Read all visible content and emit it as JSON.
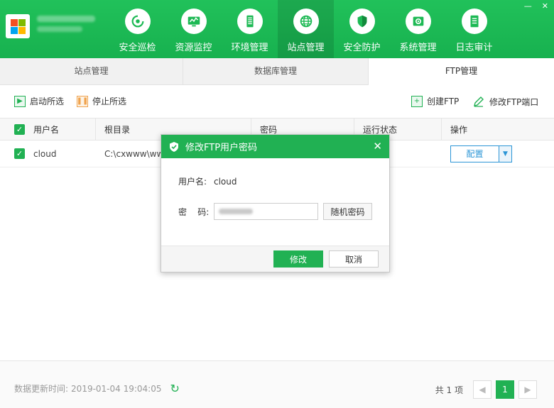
{
  "header": {
    "nav": [
      {
        "label": "安全巡检",
        "icon": "scan-icon"
      },
      {
        "label": "资源监控",
        "icon": "monitor-chart-icon"
      },
      {
        "label": "环境管理",
        "icon": "server-icon"
      },
      {
        "label": "站点管理",
        "icon": "globe-icon",
        "active": true
      },
      {
        "label": "安全防护",
        "icon": "shield-icon"
      },
      {
        "label": "系统管理",
        "icon": "settings-icon"
      },
      {
        "label": "日志审计",
        "icon": "document-icon"
      }
    ],
    "window": {
      "minimize": "—",
      "close": "✕"
    }
  },
  "subtabs": [
    "站点管理",
    "数据库管理",
    "FTP管理"
  ],
  "toolbar": {
    "start": "启动所选",
    "stop": "停止所选",
    "create": "创建FTP",
    "modify_port": "修改FTP端口"
  },
  "table": {
    "headers": [
      "用户名",
      "根目录",
      "密码",
      "运行状态",
      "操作"
    ],
    "rows": [
      {
        "user": "cloud",
        "root": "C:\\cxwww\\www",
        "password": "",
        "state": "",
        "action": "配置"
      }
    ]
  },
  "dialog": {
    "title": "修改FTP用户密码",
    "username_label": "用户名:",
    "username": "cloud",
    "password_label": "密    码:",
    "random_button": "随机密码",
    "ok": "修改",
    "cancel": "取消"
  },
  "footer": {
    "update_label": "数据更新时间:",
    "update_time": "2019-01-04 19:04:05",
    "total": "共 1 项",
    "current_page": "1"
  },
  "colors": {
    "primary": "#21b153",
    "accent_blue": "#2b95d6",
    "orange": "#f0a24c"
  }
}
